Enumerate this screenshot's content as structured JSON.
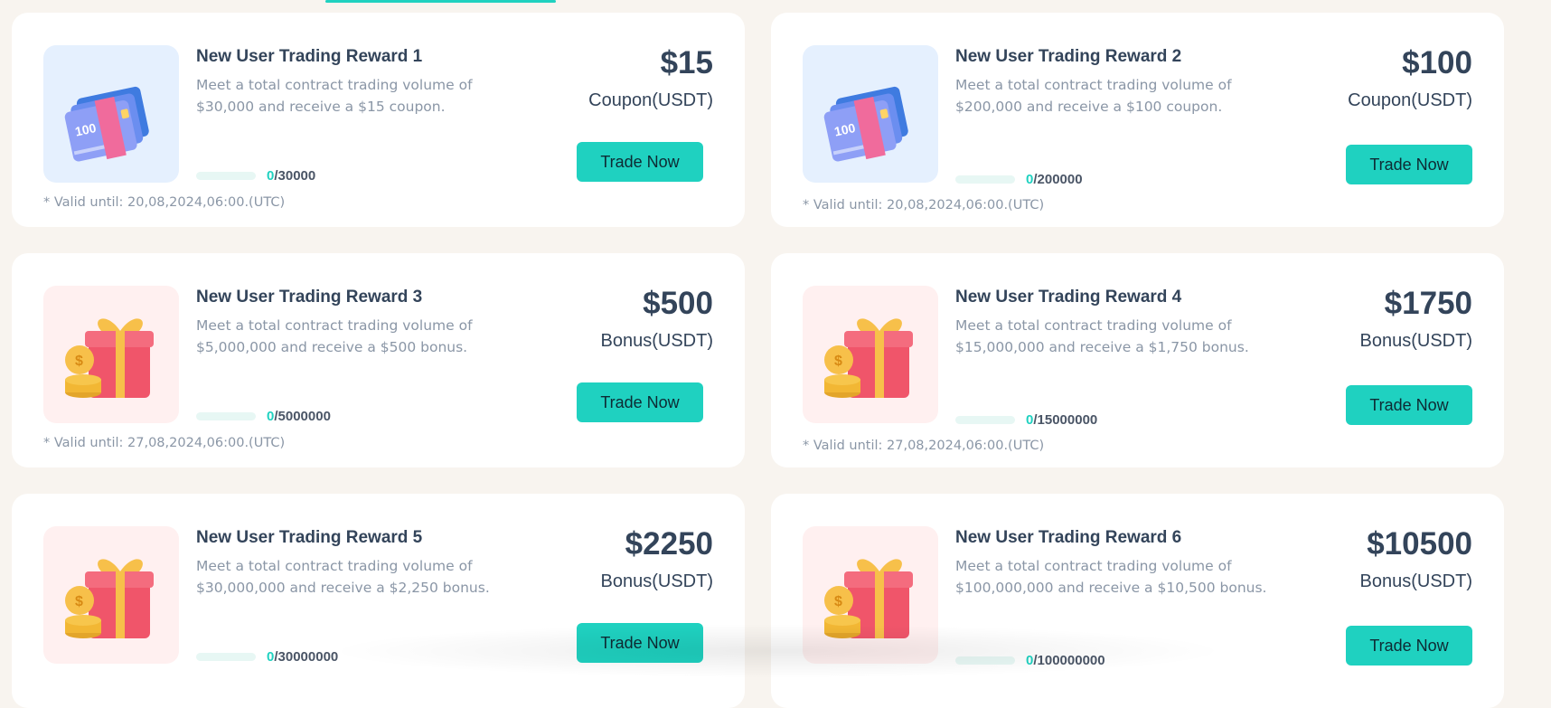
{
  "colors": {
    "accent": "#1fd1c0",
    "background": "#f8f4ef",
    "card": "#ffffff",
    "title": "#33445a",
    "muted": "#8a96a6"
  },
  "rewards": [
    {
      "title": "New User Trading Reward 1",
      "desc_line1": "Meet a total contract trading volume of",
      "desc_line2": "$30,000 and receive a $15 coupon.",
      "amount": "$15",
      "unit": "Coupon(USDT)",
      "button": "Trade Now",
      "progress_current": "0",
      "progress_total": "/30000",
      "progress_fraction": 0,
      "valid": "* Valid until: 20,08,2024,06:00.(UTC)",
      "icon": "coupon-cards-icon"
    },
    {
      "title": "New User Trading Reward 2",
      "desc_line1": "Meet a total contract trading volume of",
      "desc_line2": "$200,000 and receive a $100 coupon.",
      "amount": "$100",
      "unit": "Coupon(USDT)",
      "button": "Trade Now",
      "progress_current": "0",
      "progress_total": "/200000",
      "progress_fraction": 0,
      "valid": "* Valid until: 20,08,2024,06:00.(UTC)",
      "icon": "coupon-cards-icon"
    },
    {
      "title": "New User Trading Reward 3",
      "desc_line1": "Meet a total contract trading volume of",
      "desc_line2": "$5,000,000 and receive a $500 bonus.",
      "amount": "$500",
      "unit": "Bonus(USDT)",
      "button": "Trade Now",
      "progress_current": "0",
      "progress_total": "/5000000",
      "progress_fraction": 0,
      "valid": "* Valid until: 27,08,2024,06:00.(UTC)",
      "icon": "gift-box-icon"
    },
    {
      "title": "New User Trading Reward 4",
      "desc_line1": "Meet a total contract trading volume of",
      "desc_line2": "$15,000,000 and receive a $1,750 bonus.",
      "amount": "$1750",
      "unit": "Bonus(USDT)",
      "button": "Trade Now",
      "progress_current": "0",
      "progress_total": "/15000000",
      "progress_fraction": 0,
      "valid": "* Valid until: 27,08,2024,06:00.(UTC)",
      "icon": "gift-box-icon"
    },
    {
      "title": "New User Trading Reward 5",
      "desc_line1": "Meet a total contract trading volume of",
      "desc_line2": "$30,000,000 and receive a $2,250 bonus.",
      "amount": "$2250",
      "unit": "Bonus(USDT)",
      "button": "Trade Now",
      "progress_current": "0",
      "progress_total": "/30000000",
      "progress_fraction": 0,
      "valid": "",
      "icon": "gift-box-icon"
    },
    {
      "title": "New User Trading Reward 6",
      "desc_line1": "Meet a total contract trading volume of",
      "desc_line2": "$100,000,000 and receive a $10,500 bonus.",
      "amount": "$10500",
      "unit": "Bonus(USDT)",
      "button": "Trade Now",
      "progress_current": "0",
      "progress_total": "/100000000",
      "progress_fraction": 0,
      "valid": "",
      "icon": "gift-box-icon"
    }
  ]
}
